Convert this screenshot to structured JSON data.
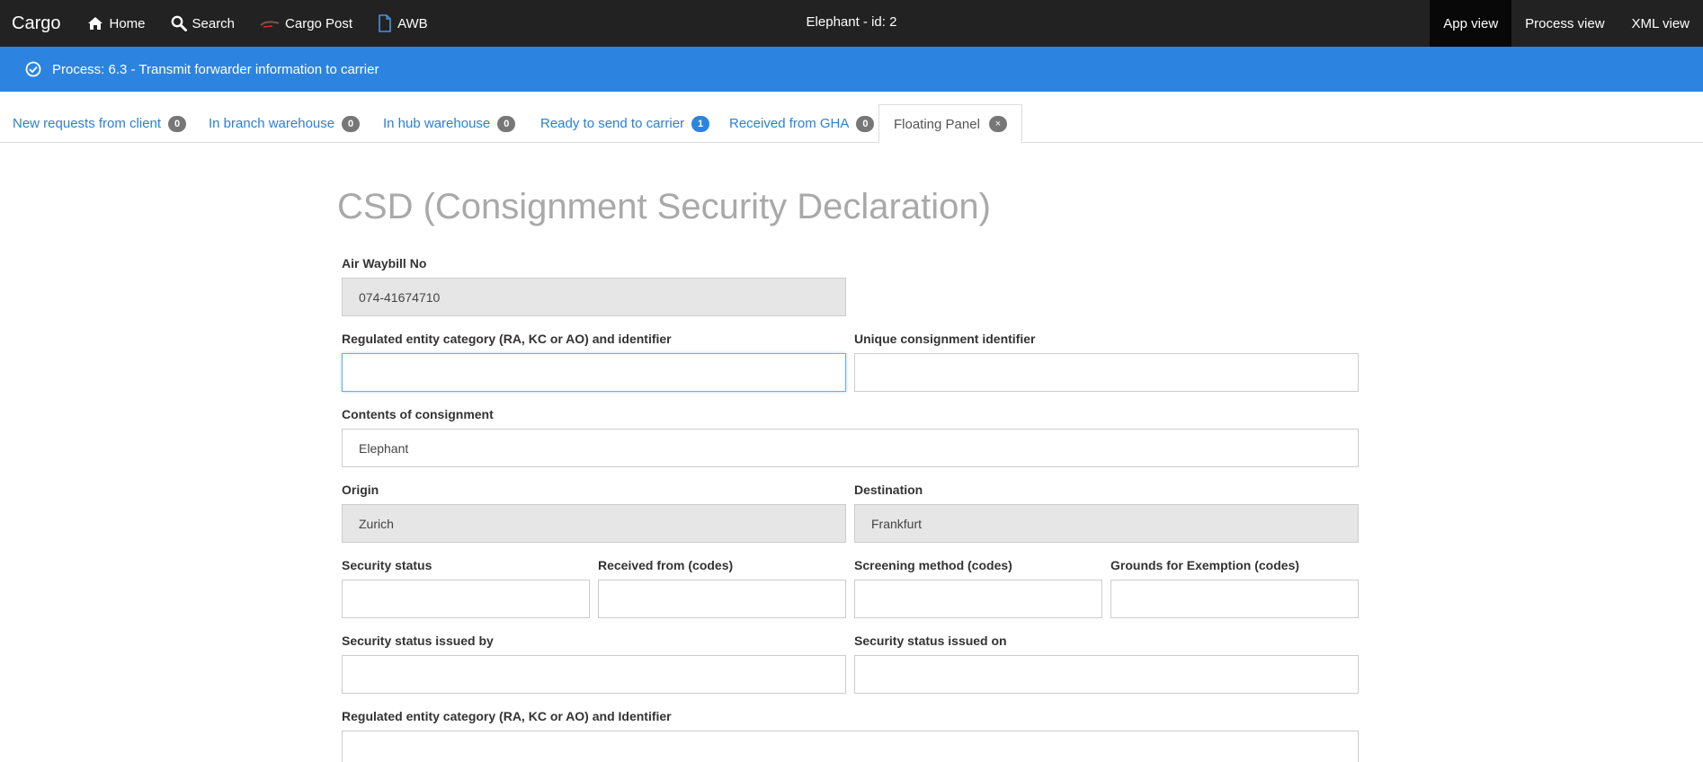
{
  "navbar": {
    "brand": "Cargo",
    "items": [
      {
        "label": "Home",
        "icon": "home-icon"
      },
      {
        "label": "Search",
        "icon": "search-icon"
      },
      {
        "label": "Cargo Post",
        "icon": "cargo-post-icon"
      },
      {
        "label": "AWB",
        "icon": "document-icon"
      }
    ],
    "center_title": "Elephant - id: 2",
    "right_tabs": [
      "App view",
      "Process view",
      "XML view"
    ],
    "active_right_tab": "App view"
  },
  "process_bar": {
    "text": "Process: 6.3 - Transmit forwarder information to carrier",
    "icon": "check-circle-icon"
  },
  "tabs": [
    {
      "label": "New requests from client",
      "badge": "0"
    },
    {
      "label": "In branch warehouse",
      "badge": "0"
    },
    {
      "label": "In hub warehouse",
      "badge": "0"
    },
    {
      "label": "Ready to send to carrier",
      "badge": "1"
    },
    {
      "label": "Received from GHA",
      "badge": "0"
    },
    {
      "label": "Floating Panel",
      "close": "×"
    }
  ],
  "form": {
    "title": "CSD (Consignment Security Declaration)",
    "awb_label": "Air Waybill No",
    "awb_value": "074-41674710",
    "reg_entity_label": "Regulated entity category (RA, KC or AO) and identifier",
    "reg_entity_value": "",
    "unique_id_label": "Unique consignment identifier",
    "unique_id_value": "",
    "contents_label": "Contents of consignment",
    "contents_value": "Elephant",
    "origin_label": "Origin",
    "origin_value": "Zurich",
    "destination_label": "Destination",
    "destination_value": "Frankfurt",
    "security_status_label": "Security status",
    "received_from_label": "Received from (codes)",
    "screening_method_label": "Screening method (codes)",
    "grounds_label": "Grounds for Exemption (codes)",
    "issued_by_label": "Security status issued by",
    "issued_on_label": "Security status issued on",
    "reg_entity2_label": "Regulated entity category (RA, KC or AO) and Identifier"
  },
  "colors": {
    "navbar_bg": "#222222",
    "process_bar_bg": "#2c84e0",
    "link": "#2c7fd6",
    "readonly_bg": "#e6e6e6"
  }
}
